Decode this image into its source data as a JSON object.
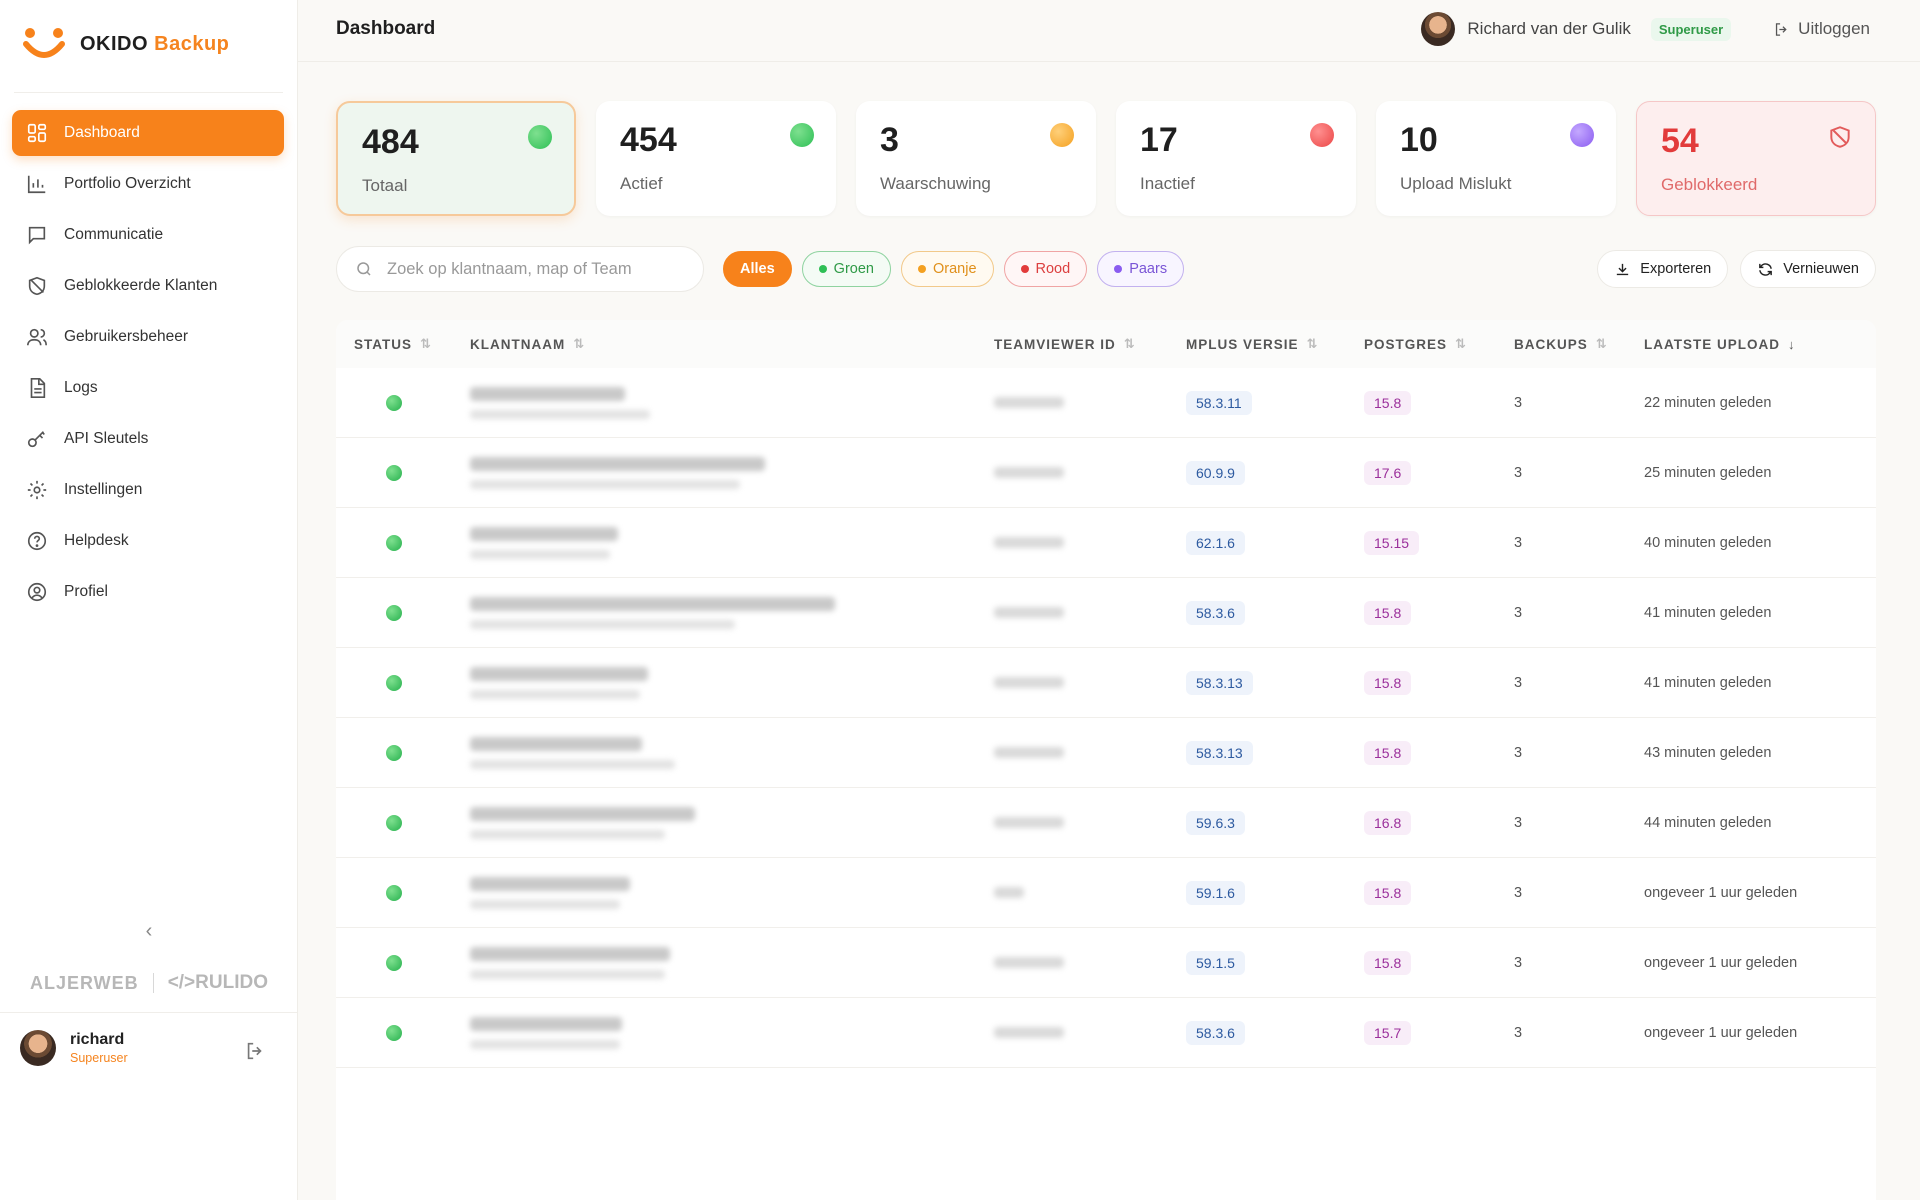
{
  "app": {
    "logo_main": "OKIDO",
    "logo_accent": "Backup"
  },
  "sidebar": {
    "items": [
      {
        "label": "Dashboard",
        "icon": "grid-icon",
        "active": true
      },
      {
        "label": "Portfolio Overzicht",
        "icon": "bar-chart-icon"
      },
      {
        "label": "Communicatie",
        "icon": "chat-icon"
      },
      {
        "label": "Geblokkeerde Klanten",
        "icon": "shield-off-icon"
      },
      {
        "label": "Gebruikersbeheer",
        "icon": "users-icon"
      },
      {
        "label": "Logs",
        "icon": "document-icon"
      },
      {
        "label": "API Sleutels",
        "icon": "key-icon"
      },
      {
        "label": "Instellingen",
        "icon": "gear-icon"
      },
      {
        "label": "Helpdesk",
        "icon": "help-icon"
      },
      {
        "label": "Profiel",
        "icon": "user-circle-icon"
      }
    ],
    "collapse": "‹",
    "partner1": "ALJERWEB",
    "partner2": "</>RULIDO",
    "user": {
      "name": "richard",
      "role": "Superuser"
    }
  },
  "header": {
    "title": "Dashboard",
    "user_name": "Richard van der Gulik",
    "user_badge": "Superuser",
    "logout": "Uitloggen"
  },
  "stats": [
    {
      "value": "484",
      "label": "Totaal",
      "status": "green"
    },
    {
      "value": "454",
      "label": "Actief",
      "status": "green"
    },
    {
      "value": "3",
      "label": "Waarschuwing",
      "status": "orange"
    },
    {
      "value": "17",
      "label": "Inactief",
      "status": "red"
    },
    {
      "value": "10",
      "label": "Upload Mislukt",
      "status": "purple"
    },
    {
      "value": "54",
      "label": "Geblokkeerd",
      "status": "blocked"
    }
  ],
  "search": {
    "placeholder": "Zoek op klantnaam, map of Team",
    "value": ""
  },
  "filters": [
    "Alles",
    "Groen",
    "Oranje",
    "Rood",
    "Paars"
  ],
  "actions": {
    "export": "Exporteren",
    "refresh": "Vernieuwen"
  },
  "table": {
    "columns": [
      "STATUS",
      "KLANTNAAM",
      "TEAMVIEWER ID",
      "MPLUS VERSIE",
      "POSTGRES",
      "BACKUPS",
      "LAATSTE UPLOAD"
    ],
    "rows": [
      {
        "mplus": "58.3.11",
        "postgres": "15.8",
        "backups": "3",
        "upload": "22 minuten geleden"
      },
      {
        "mplus": "60.9.9",
        "postgres": "17.6",
        "backups": "3",
        "upload": "25 minuten geleden"
      },
      {
        "mplus": "62.1.6",
        "postgres": "15.15",
        "backups": "3",
        "upload": "40 minuten geleden"
      },
      {
        "mplus": "58.3.6",
        "postgres": "15.8",
        "backups": "3",
        "upload": "41 minuten geleden"
      },
      {
        "mplus": "58.3.13",
        "postgres": "15.8",
        "backups": "3",
        "upload": "41 minuten geleden"
      },
      {
        "mplus": "58.3.13",
        "postgres": "15.8",
        "backups": "3",
        "upload": "43 minuten geleden"
      },
      {
        "mplus": "59.6.3",
        "postgres": "16.8",
        "backups": "3",
        "upload": "44 minuten geleden"
      },
      {
        "mplus": "59.1.6",
        "postgres": "15.8",
        "backups": "3",
        "upload": "ongeveer 1 uur geleden"
      },
      {
        "mplus": "59.1.5",
        "postgres": "15.8",
        "backups": "3",
        "upload": "ongeveer 1 uur geleden"
      },
      {
        "mplus": "58.3.6",
        "postgres": "15.7",
        "backups": "3",
        "upload": "ongeveer 1 uur geleden"
      }
    ]
  }
}
